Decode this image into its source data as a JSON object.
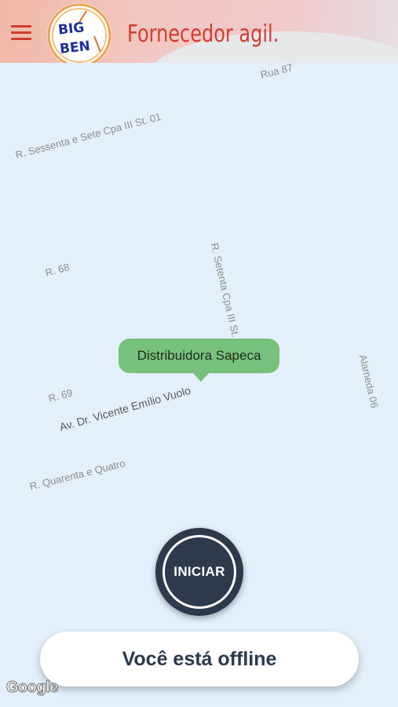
{
  "header": {
    "app_title": "Fornecedor agil.",
    "logo_text_top": "BIG",
    "logo_text_bottom": "BEN",
    "menu_icon": "hamburger-menu-icon",
    "accent_color": "#d63a2e"
  },
  "map": {
    "streets": [
      "Rua 87",
      "R. Sessenta e Sete Cpa III St. 01",
      "R. 68",
      "R. Setenta Cpa III St. 0",
      "Alameda 06",
      "R. 69",
      "Av. Dr. Vicente Emílio Vuolo",
      "R. Quarenta e Quatro"
    ],
    "marker_label": "Distribuidora Sapeca",
    "marker_color": "#78c17d",
    "attribution": "Google"
  },
  "controls": {
    "start_label": "INICIAR",
    "status_label": "Você está offline",
    "button_color": "#2c3a4c"
  }
}
